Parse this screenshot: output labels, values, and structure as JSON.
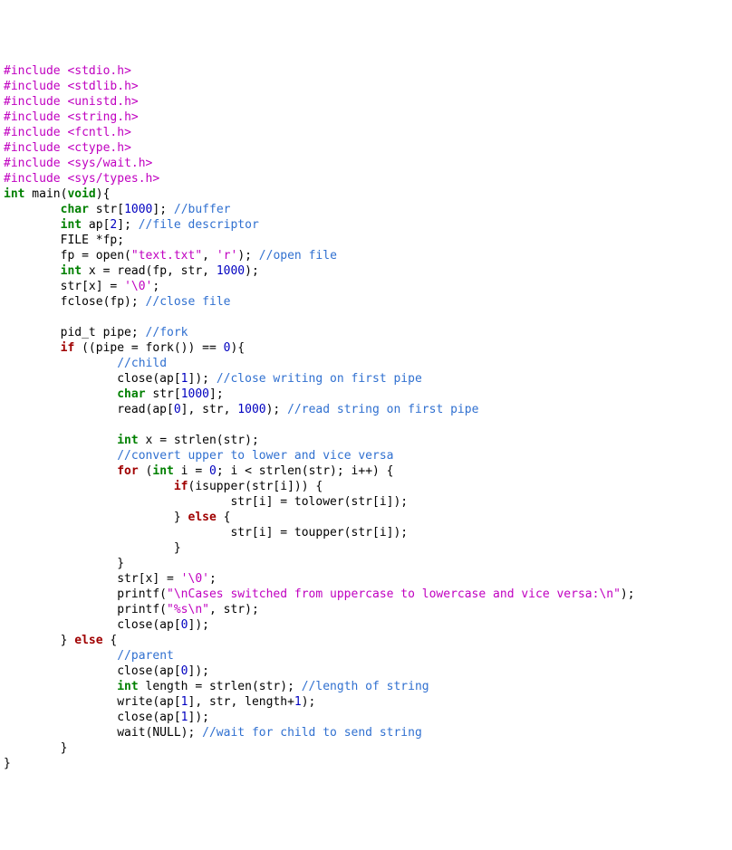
{
  "code": {
    "lines": [
      [
        [
          "preproc",
          "#include"
        ],
        [
          "",
          ""
        ],
        [
          "",
          " "
        ],
        [
          "string",
          "<stdio.h>"
        ]
      ],
      [
        [
          "preproc",
          "#include"
        ],
        [
          "",
          " "
        ],
        [
          "string",
          "<stdlib.h>"
        ]
      ],
      [
        [
          "preproc",
          "#include"
        ],
        [
          "",
          " "
        ],
        [
          "string",
          "<unistd.h>"
        ]
      ],
      [
        [
          "preproc",
          "#include"
        ],
        [
          "",
          " "
        ],
        [
          "string",
          "<string.h>"
        ]
      ],
      [
        [
          "preproc",
          "#include"
        ],
        [
          "",
          " "
        ],
        [
          "string",
          "<fcntl.h>"
        ]
      ],
      [
        [
          "preproc",
          "#include"
        ],
        [
          "",
          " "
        ],
        [
          "string",
          "<ctype.h>"
        ]
      ],
      [
        [
          "preproc",
          "#include"
        ],
        [
          "",
          " "
        ],
        [
          "string",
          "<sys/wait.h>"
        ]
      ],
      [
        [
          "preproc",
          "#include"
        ],
        [
          "",
          " "
        ],
        [
          "string",
          "<sys/types.h>"
        ]
      ],
      [
        [
          "keyword",
          "int"
        ],
        [
          "",
          " main("
        ],
        [
          "keyword",
          "void"
        ],
        [
          "",
          "){"
        ]
      ],
      [
        [
          "",
          "        "
        ],
        [
          "keyword",
          "char"
        ],
        [
          "",
          " str["
        ],
        [
          "number",
          "1000"
        ],
        [
          "",
          "]; "
        ],
        [
          "comment",
          "//buffer"
        ]
      ],
      [
        [
          "",
          "        "
        ],
        [
          "keyword",
          "int"
        ],
        [
          "",
          " ap["
        ],
        [
          "number",
          "2"
        ],
        [
          "",
          "]; "
        ],
        [
          "comment",
          "//file descriptor"
        ]
      ],
      [
        [
          "",
          "        FILE *fp;"
        ]
      ],
      [
        [
          "",
          "        fp = open("
        ],
        [
          "string",
          "\"text.txt\""
        ],
        [
          "",
          ", "
        ],
        [
          "charlit",
          "'r'"
        ],
        [
          "",
          "); "
        ],
        [
          "comment",
          "//open file"
        ]
      ],
      [
        [
          "",
          "        "
        ],
        [
          "keyword",
          "int"
        ],
        [
          "",
          " x = read(fp, str, "
        ],
        [
          "number",
          "1000"
        ],
        [
          "",
          ");"
        ]
      ],
      [
        [
          "",
          "        str[x] = "
        ],
        [
          "charlit",
          "'\\0'"
        ],
        [
          "",
          ";"
        ]
      ],
      [
        [
          "",
          "        fclose(fp); "
        ],
        [
          "comment",
          "//close file"
        ]
      ],
      [
        [
          "",
          ""
        ]
      ],
      [
        [
          "",
          "        pid_t pipe; "
        ],
        [
          "comment",
          "//fork"
        ]
      ],
      [
        [
          "",
          "        "
        ],
        [
          "kwbold",
          "if"
        ],
        [
          "",
          " ((pipe = fork()) == "
        ],
        [
          "number",
          "0"
        ],
        [
          "",
          "){"
        ]
      ],
      [
        [
          "",
          "                "
        ],
        [
          "comment",
          "//child"
        ]
      ],
      [
        [
          "",
          "                close(ap["
        ],
        [
          "number",
          "1"
        ],
        [
          "",
          "]); "
        ],
        [
          "comment",
          "//close writing on first pipe"
        ]
      ],
      [
        [
          "",
          "                "
        ],
        [
          "keyword",
          "char"
        ],
        [
          "",
          " str["
        ],
        [
          "number",
          "1000"
        ],
        [
          "",
          "];"
        ]
      ],
      [
        [
          "",
          "                read(ap["
        ],
        [
          "number",
          "0"
        ],
        [
          "",
          "], str, "
        ],
        [
          "number",
          "1000"
        ],
        [
          "",
          "); "
        ],
        [
          "comment",
          "//read string on first pipe"
        ]
      ],
      [
        [
          "",
          ""
        ]
      ],
      [
        [
          "",
          "                "
        ],
        [
          "keyword",
          "int"
        ],
        [
          "",
          " x = strlen(str);"
        ]
      ],
      [
        [
          "",
          "                "
        ],
        [
          "comment",
          "//convert upper to lower and vice versa"
        ]
      ],
      [
        [
          "",
          "                "
        ],
        [
          "kwbold",
          "for"
        ],
        [
          "",
          " ("
        ],
        [
          "keyword",
          "int"
        ],
        [
          "",
          " i = "
        ],
        [
          "number",
          "0"
        ],
        [
          "",
          "; i < strlen(str); i++) {"
        ]
      ],
      [
        [
          "",
          "                        "
        ],
        [
          "kwbold",
          "if"
        ],
        [
          "",
          "(isupper(str[i])) {"
        ]
      ],
      [
        [
          "",
          "                                str[i] = tolower(str[i]);"
        ]
      ],
      [
        [
          "",
          "                        } "
        ],
        [
          "kwbold",
          "else"
        ],
        [
          "",
          " {"
        ]
      ],
      [
        [
          "",
          "                                str[i] = toupper(str[i]);"
        ]
      ],
      [
        [
          "",
          "                        }"
        ]
      ],
      [
        [
          "",
          "                }"
        ]
      ],
      [
        [
          "",
          "                str[x] = "
        ],
        [
          "charlit",
          "'\\0'"
        ],
        [
          "",
          ";"
        ]
      ],
      [
        [
          "",
          "                printf("
        ],
        [
          "string",
          "\"\\nCases switched from uppercase to lowercase and vice versa:\\n\""
        ],
        [
          "",
          ");"
        ]
      ],
      [
        [
          "",
          "                printf("
        ],
        [
          "string",
          "\"%s\\n\""
        ],
        [
          "",
          ", str);"
        ]
      ],
      [
        [
          "",
          "                close(ap["
        ],
        [
          "number",
          "0"
        ],
        [
          "",
          "]);"
        ]
      ],
      [
        [
          "",
          "        } "
        ],
        [
          "kwbold",
          "else"
        ],
        [
          "",
          " {"
        ]
      ],
      [
        [
          "",
          "                "
        ],
        [
          "comment",
          "//parent"
        ]
      ],
      [
        [
          "",
          "                close(ap["
        ],
        [
          "number",
          "0"
        ],
        [
          "",
          "]);"
        ]
      ],
      [
        [
          "",
          "                "
        ],
        [
          "keyword",
          "int"
        ],
        [
          "",
          " length = strlen(str); "
        ],
        [
          "comment",
          "//length of string"
        ]
      ],
      [
        [
          "",
          "                write(ap["
        ],
        [
          "number",
          "1"
        ],
        [
          "",
          "], str, length+"
        ],
        [
          "number",
          "1"
        ],
        [
          "",
          ");"
        ]
      ],
      [
        [
          "",
          "                close(ap["
        ],
        [
          "number",
          "1"
        ],
        [
          "",
          "]);"
        ]
      ],
      [
        [
          "",
          "                wait(NULL); "
        ],
        [
          "comment",
          "//wait for child to send string"
        ]
      ],
      [
        [
          "",
          "        }"
        ]
      ],
      [
        [
          "",
          "}"
        ]
      ]
    ]
  }
}
